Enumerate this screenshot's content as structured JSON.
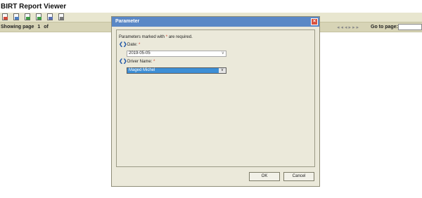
{
  "app": {
    "title": "BIRT Report Viewer"
  },
  "toolbar": {
    "icons": [
      {
        "name": "toc-icon"
      },
      {
        "name": "parameters-icon"
      },
      {
        "name": "export-data-icon"
      },
      {
        "name": "export-report-icon"
      },
      {
        "name": "print-icon"
      },
      {
        "name": "print-server-icon"
      }
    ]
  },
  "navbar": {
    "showing_label": "Showing page",
    "current_page": "1",
    "of_label": "of",
    "go_to_label": "Go to page:"
  },
  "dialog": {
    "title": "Parameter",
    "required_note_prefix": "Parameters marked with",
    "required_star": "*",
    "required_note_suffix": "are required.",
    "params": [
      {
        "label": "Date:",
        "star": "*",
        "value": "2019-05-05"
      },
      {
        "label": "Driver Name:",
        "star": "*",
        "value": "Maged Michel"
      }
    ],
    "ok_label": "OK",
    "cancel_label": "Cancel"
  }
}
